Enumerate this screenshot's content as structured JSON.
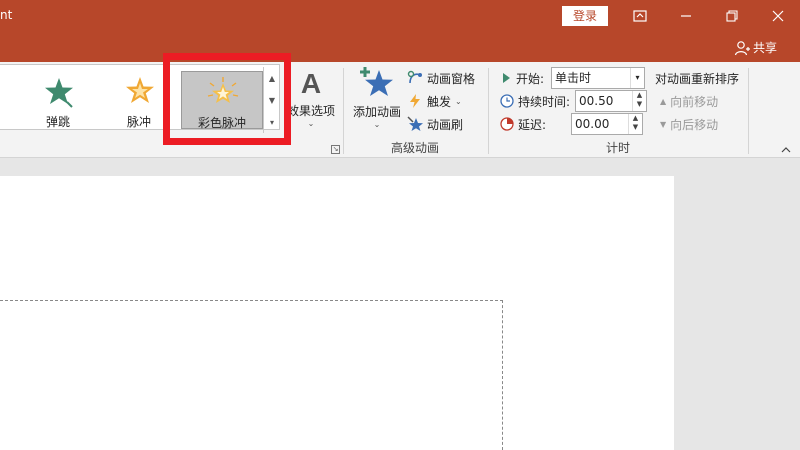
{
  "titlebar": {
    "app_title_fragment": "nt",
    "login_label": "登录",
    "share_label": "共享",
    "icons": [
      "ribbon-display-icon",
      "minimize-icon",
      "restore-icon",
      "close-icon",
      "person-icon"
    ]
  },
  "ribbon": {
    "gallery": {
      "items": [
        {
          "label": "弹跳",
          "icon": "bounce-star-icon",
          "selected": false
        },
        {
          "label": "脉冲",
          "icon": "pulse-star-icon",
          "selected": false
        },
        {
          "label": "彩色脉冲",
          "icon": "color-pulse-star-icon",
          "selected": true
        }
      ]
    },
    "effect_options_label": "效果选项",
    "advanced": {
      "add_animation_label": "添加动画",
      "animation_pane_label": "动画窗格",
      "trigger_label": "触发",
      "animation_painter_label": "动画刷",
      "group_label": "高级动画"
    },
    "timing": {
      "start_label": "开始:",
      "start_value": "单击时",
      "duration_label": "持续时间:",
      "duration_value": "00.50",
      "delay_label": "延迟:",
      "delay_value": "00.00",
      "reorder_label": "对动画重新排序",
      "move_earlier_label": "向前移动",
      "move_later_label": "向后移动",
      "group_label": "计时"
    }
  },
  "colors": {
    "titlebar": "#b7472a",
    "highlight": "#ec1c24",
    "ribbon_bg": "#f3f3f3",
    "workspace_bg": "#e6e6e6"
  }
}
